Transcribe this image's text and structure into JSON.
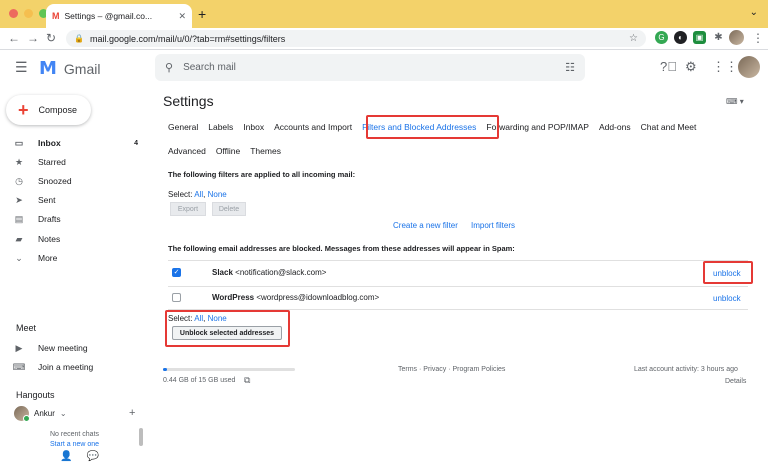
{
  "browser": {
    "tab_title": "Settings –",
    "tab_title_suffix": "@gmail.co...",
    "url": "mail.google.com/mail/u/0/?tab=rm#settings/filters"
  },
  "header": {
    "app_name": "Gmail",
    "search_placeholder": "Search mail"
  },
  "sidebar": {
    "compose_label": "Compose",
    "items": [
      {
        "label": "Inbox",
        "icon": "inbox-icon",
        "count": "4",
        "bold": true
      },
      {
        "label": "Starred",
        "icon": "star-icon"
      },
      {
        "label": "Snoozed",
        "icon": "clock-icon"
      },
      {
        "label": "Sent",
        "icon": "send-icon"
      },
      {
        "label": "Drafts",
        "icon": "draft-icon"
      },
      {
        "label": "Notes",
        "icon": "label-icon"
      },
      {
        "label": "More",
        "icon": "chevron-down-icon"
      }
    ],
    "meet": {
      "title": "Meet",
      "new_meeting": "New meeting",
      "join_meeting": "Join a meeting"
    },
    "hangouts": {
      "title": "Hangouts",
      "user": "Ankur",
      "no_chats": "No recent chats",
      "start_chat": "Start a new one"
    }
  },
  "settings": {
    "title": "Settings",
    "tabs_row1": [
      "General",
      "Labels",
      "Inbox",
      "Accounts and Import",
      "Filters and Blocked Addresses",
      "Forwarding and POP/IMAP",
      "Add-ons",
      "Chat and Meet"
    ],
    "tabs_row2": [
      "Advanced",
      "Offline",
      "Themes"
    ],
    "active_tab": "Filters and Blocked Addresses",
    "filters_heading": "The following filters are applied to all incoming mail:",
    "select_label": "Select:",
    "select_all": "All",
    "select_none": "None",
    "export_label": "Export",
    "delete_label": "Delete",
    "create_filter": "Create a new filter",
    "import_filters": "Import filters",
    "blocked_heading": "The following email addresses are blocked. Messages from these addresses will appear in Spam:",
    "blocked": [
      {
        "name": "Slack",
        "email": "<notification@slack.com>",
        "checked": true,
        "action": "unblock"
      },
      {
        "name": "WordPress",
        "email": "<wordpress@idownloadblog.com>",
        "checked": false,
        "action": "unblock"
      }
    ],
    "unblock_selected": "Unblock selected addresses"
  },
  "footer": {
    "storage": "0.44 GB of 15 GB used",
    "storage_fraction": 0.03,
    "terms": "Terms",
    "privacy": "Privacy",
    "program_policies": "Program Policies",
    "last_activity": "Last account activity: 3 hours ago",
    "details": "Details"
  },
  "colors": {
    "highlight": "#e53935",
    "link": "#1a73e8",
    "tabbar": "#f3d26a"
  }
}
